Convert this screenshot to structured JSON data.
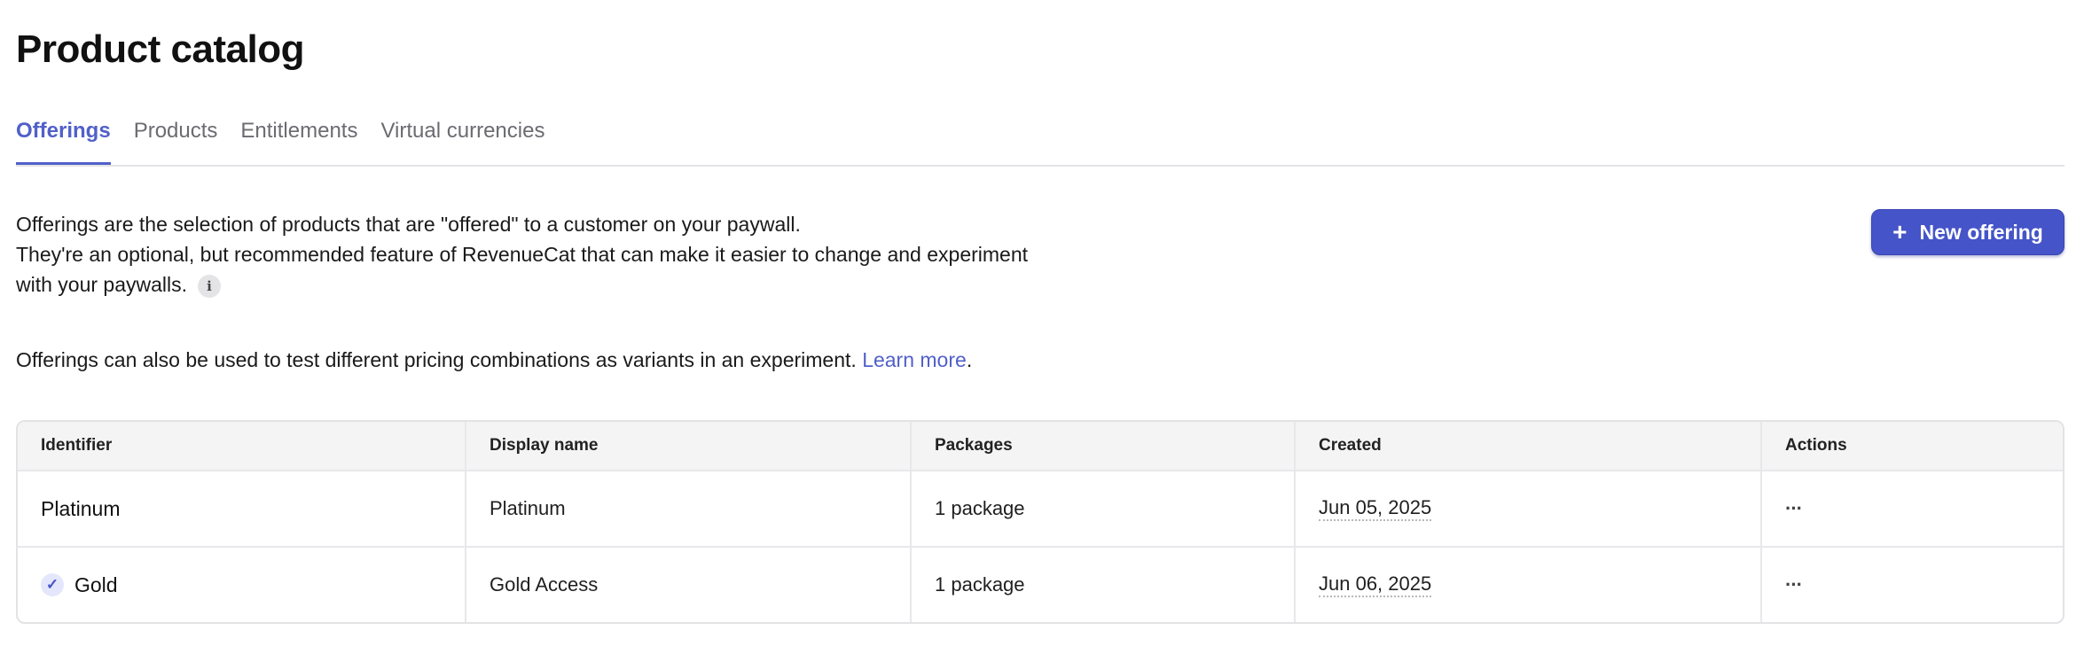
{
  "page": {
    "title": "Product catalog"
  },
  "tabs": [
    {
      "label": "Offerings",
      "active": true
    },
    {
      "label": "Products",
      "active": false
    },
    {
      "label": "Entitlements",
      "active": false
    },
    {
      "label": "Virtual currencies",
      "active": false
    }
  ],
  "intro": {
    "line1": "Offerings are the selection of products that are \"offered\" to a customer on your paywall.",
    "line2": "They're an optional, but recommended feature of RevenueCat that can make it easier to change and experiment",
    "line3": "with your paywalls.",
    "info_icon": "i",
    "secondary": "Offerings can also be used to test different pricing combinations as variants in an experiment.",
    "learn_more": "Learn more",
    "period": "."
  },
  "actions": {
    "new_offering_label": "New offering",
    "new_offering_icon": "+"
  },
  "table": {
    "columns": [
      "Identifier",
      "Display name",
      "Packages",
      "Created",
      "Actions"
    ],
    "rows": [
      {
        "identifier": "Platinum",
        "display_name": "Platinum",
        "packages": "1 package",
        "created": "Jun 05, 2025",
        "actions": "···",
        "current": false
      },
      {
        "identifier": "Gold",
        "display_name": "Gold Access",
        "packages": "1 package",
        "created": "Jun 06, 2025",
        "actions": "···",
        "current": true,
        "current_icon": "✓"
      }
    ]
  },
  "colors": {
    "accent": "#5160c9",
    "button": "#4554c8"
  }
}
